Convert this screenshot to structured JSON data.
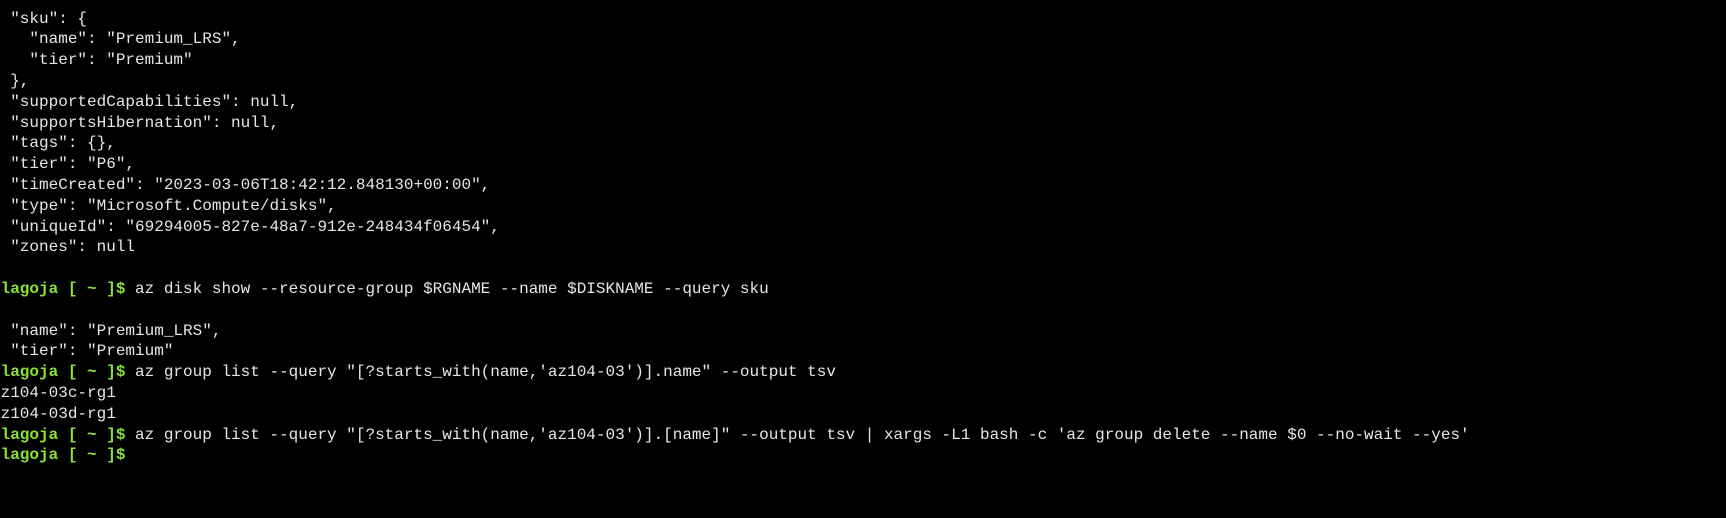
{
  "terminal": {
    "colors": {
      "background": "#000000",
      "text": "#e6e6e6",
      "prompt": "#8ae234"
    },
    "prompt": "blagoja [ ~ ]$",
    "lines": [
      {
        "kind": "output",
        "text": "  \"sku\": {"
      },
      {
        "kind": "output",
        "text": "    \"name\": \"Premium_LRS\","
      },
      {
        "kind": "output",
        "text": "    \"tier\": \"Premium\""
      },
      {
        "kind": "output",
        "text": "  },"
      },
      {
        "kind": "output",
        "text": "  \"supportedCapabilities\": null,"
      },
      {
        "kind": "output",
        "text": "  \"supportsHibernation\": null,"
      },
      {
        "kind": "output",
        "text": "  \"tags\": {},"
      },
      {
        "kind": "output",
        "text": "  \"tier\": \"P6\","
      },
      {
        "kind": "output",
        "text": "  \"timeCreated\": \"2023-03-06T18:42:12.848130+00:00\","
      },
      {
        "kind": "output",
        "text": "  \"type\": \"Microsoft.Compute/disks\","
      },
      {
        "kind": "output",
        "text": "  \"uniqueId\": \"69294005-827e-48a7-912e-248434f06454\","
      },
      {
        "kind": "output",
        "text": "  \"zones\": null"
      },
      {
        "kind": "output",
        "text": "}"
      },
      {
        "kind": "command",
        "prompt": "blagoja [ ~ ]$",
        "text": " az disk show --resource-group $RGNAME --name $DISKNAME --query sku"
      },
      {
        "kind": "output",
        "text": "{"
      },
      {
        "kind": "output",
        "text": "  \"name\": \"Premium_LRS\","
      },
      {
        "kind": "output",
        "text": "  \"tier\": \"Premium\""
      },
      {
        "kind": "command",
        "prompt": "blagoja [ ~ ]$",
        "text": " az group list --query \"[?starts_with(name,'az104-03')].name\" --output tsv"
      },
      {
        "kind": "output",
        "text": "az104-03c-rg1"
      },
      {
        "kind": "output",
        "text": "az104-03d-rg1"
      },
      {
        "kind": "command",
        "prompt": "blagoja [ ~ ]$",
        "text": " az group list --query \"[?starts_with(name,'az104-03')].[name]\" --output tsv | xargs -L1 bash -c 'az group delete --name $0 --no-wait --yes'"
      },
      {
        "kind": "command",
        "prompt": "blagoja [ ~ ]$",
        "text": ""
      }
    ]
  }
}
